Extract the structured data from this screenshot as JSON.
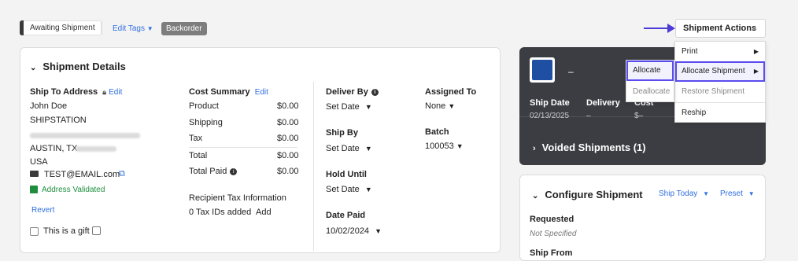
{
  "topbar": {
    "status": "Awaiting Shipment",
    "edit_tags": "Edit Tags",
    "edit_tags_caret": "▼",
    "tag_backorder": "Backorder",
    "shipment_actions": "Shipment Actions",
    "shipment_actions_caret": "▲"
  },
  "details": {
    "title": "Shipment Details",
    "ship_to_label": "Ship To Address",
    "ship_to_edit": "Edit",
    "name": "John Doe",
    "company": "SHIPSTATION",
    "city_state": "AUSTIN, TX",
    "country": "USA",
    "email": "TEST@EMAIL.com",
    "address_status": "Address Validated",
    "revert": "Revert",
    "gift_label": "This is a gift",
    "cost_summary_label": "Cost Summary",
    "cost_summary_edit": "Edit",
    "cost_rows": [
      {
        "label": "Product",
        "value": "$0.00"
      },
      {
        "label": "Shipping",
        "value": "$0.00"
      },
      {
        "label": "Tax",
        "value": "$0.00"
      },
      {
        "label": "Total",
        "value": "$0.00"
      }
    ],
    "total_paid_label": "Total Paid",
    "total_paid_value": "$0.00",
    "recipient_tax_label": "Recipient Tax Information",
    "tax_ids": "0 Tax IDs added",
    "tax_add": "Add",
    "deliver_by_label": "Deliver By",
    "deliver_by_value": "Set Date",
    "ship_by_label": "Ship By",
    "ship_by_value": "Set Date",
    "hold_until_label": "Hold Until",
    "hold_until_value": "Set Date",
    "date_paid_label": "Date Paid",
    "date_paid_value": "10/02/2024",
    "assigned_to_label": "Assigned To",
    "assigned_to_value": "None",
    "batch_label": "Batch",
    "batch_value": "100053",
    "caret": "▼"
  },
  "shipment_panel": {
    "dash": "–",
    "ship_date_label": "Ship Date",
    "ship_date_value": "02/13/2025",
    "delivery_label": "Delivery",
    "delivery_value": "–",
    "cost_label": "Cost",
    "cost_value": "$–",
    "voided": "Voided Shipments (1)"
  },
  "configure": {
    "title": "Configure Shipment",
    "ship_today": "Ship Today",
    "preset": "Preset",
    "requested_label": "Requested",
    "requested_value": "Not Specified",
    "ship_from_label": "Ship From"
  },
  "menu_main": [
    "Print",
    "Allocate Shipment",
    "Restore Shipment",
    "Reship"
  ],
  "menu_sub": [
    "Allocate",
    "Deallocate"
  ],
  "accent_color": "#5b4cf0",
  "link_color": "#2f6fde"
}
